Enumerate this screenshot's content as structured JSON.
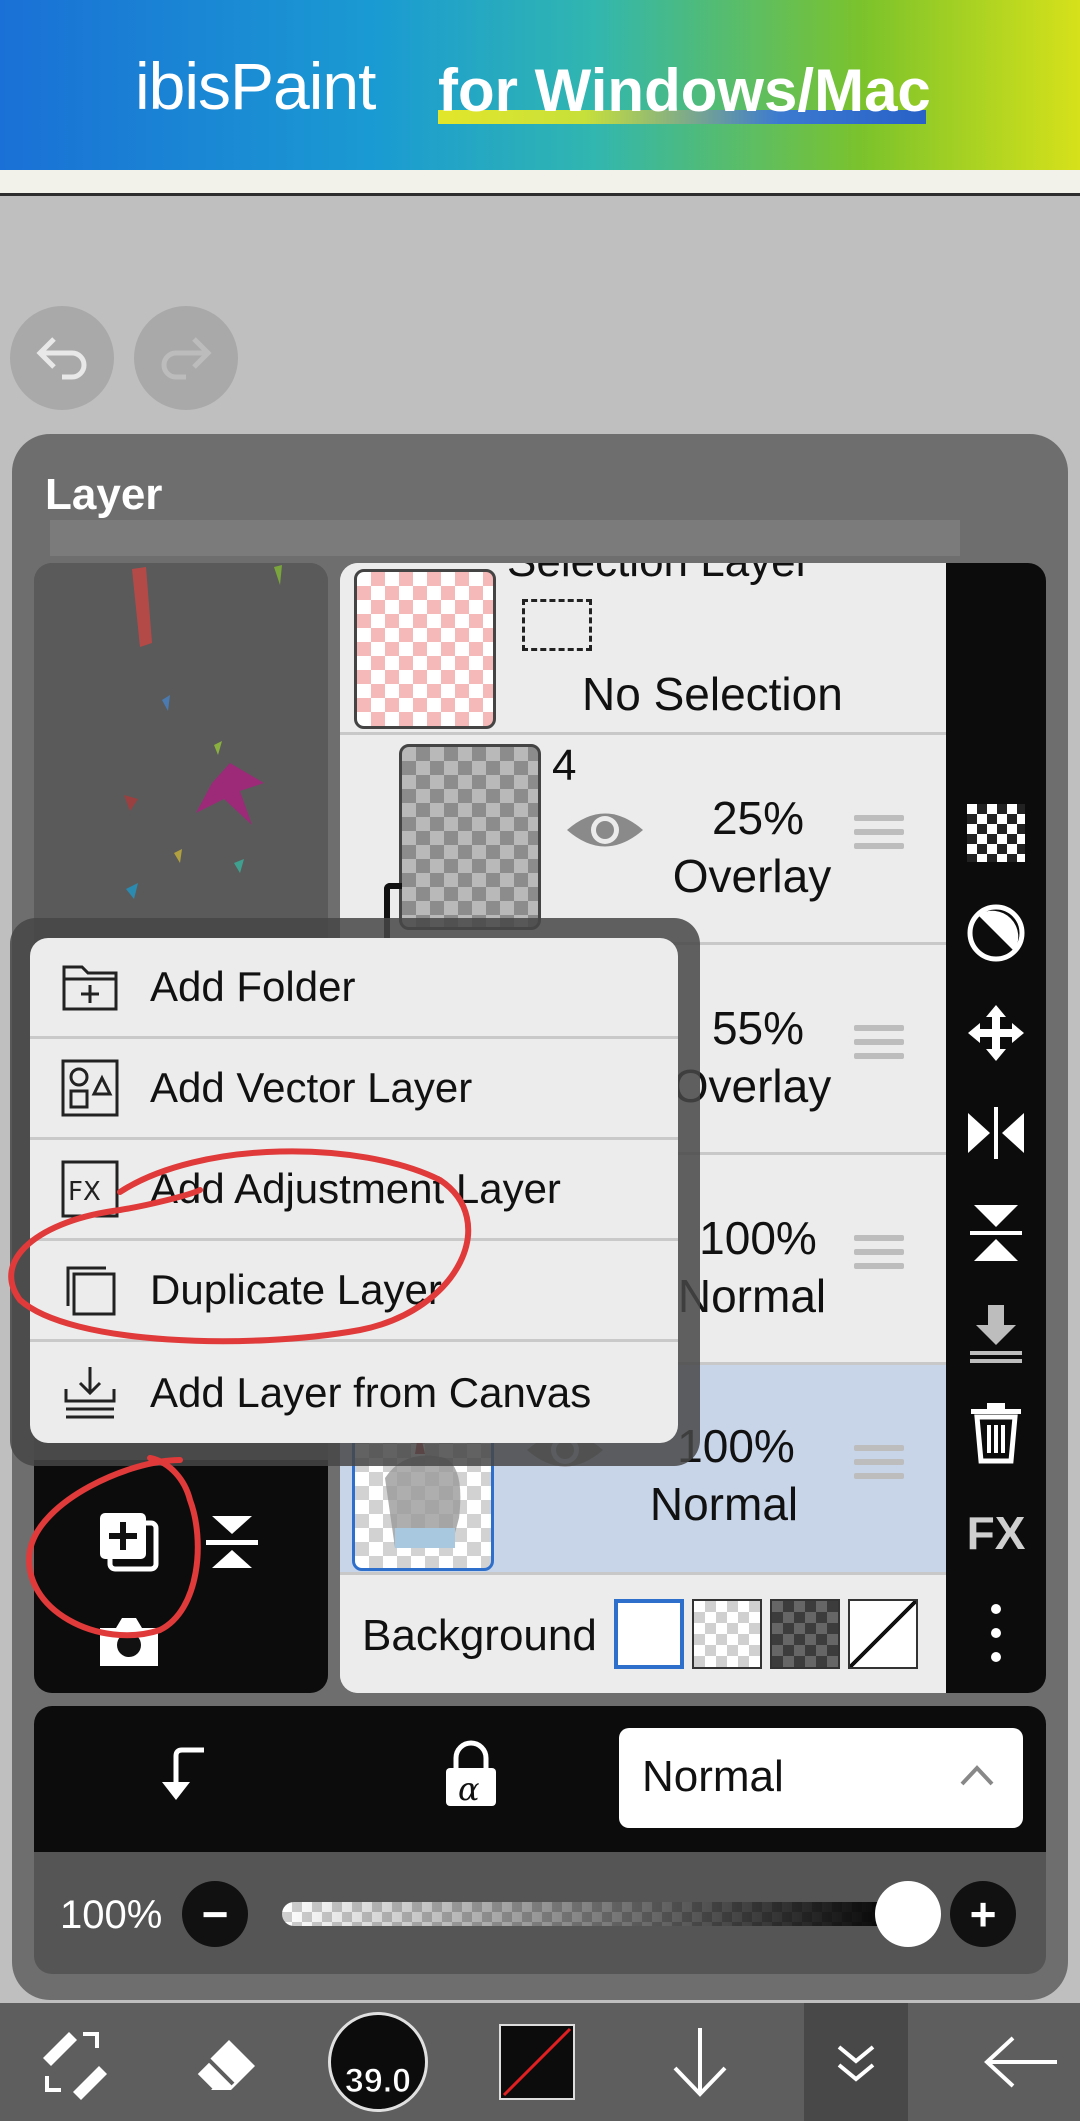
{
  "banner": {
    "logo": "ibisPaint",
    "tagline": "for Windows/Mac"
  },
  "history": {
    "undo_icon": "undo-icon",
    "redo_icon": "redo-icon"
  },
  "panel": {
    "title": "Layer",
    "layers": [
      {
        "name": "Selection Layer",
        "status": "No Selection"
      },
      {
        "number": "4",
        "opacity": "25%",
        "mode": "Overlay"
      },
      {
        "opacity": "55%",
        "mode": "Overlay"
      },
      {
        "opacity": "100%",
        "mode": "Normal"
      },
      {
        "opacity": "100%",
        "mode": "Normal",
        "selected": true
      }
    ],
    "background_label": "Background"
  },
  "menu": {
    "items": [
      {
        "label": "Add Folder",
        "icon": "folder-add-icon"
      },
      {
        "label": "Add Vector Layer",
        "icon": "vector-layer-icon"
      },
      {
        "label": "Add Adjustment Layer",
        "icon": "fx-icon"
      },
      {
        "label": "Duplicate Layer",
        "icon": "duplicate-icon"
      },
      {
        "label": "Add Layer from Canvas",
        "icon": "import-canvas-icon"
      }
    ]
  },
  "right_tools": [
    "checker-icon",
    "contrast-icon",
    "move-icon",
    "flip-horizontal-icon",
    "flip-vertical-icon",
    "merge-down-icon",
    "trash-icon",
    "fx-icon",
    "more-icon"
  ],
  "right_tools_fx_label": "FX",
  "blend": {
    "mode": "Normal"
  },
  "opacity": {
    "label": "100%",
    "value": 1.0,
    "minus": "−",
    "plus": "+"
  },
  "toolbar": {
    "brush_size": "39.0"
  }
}
